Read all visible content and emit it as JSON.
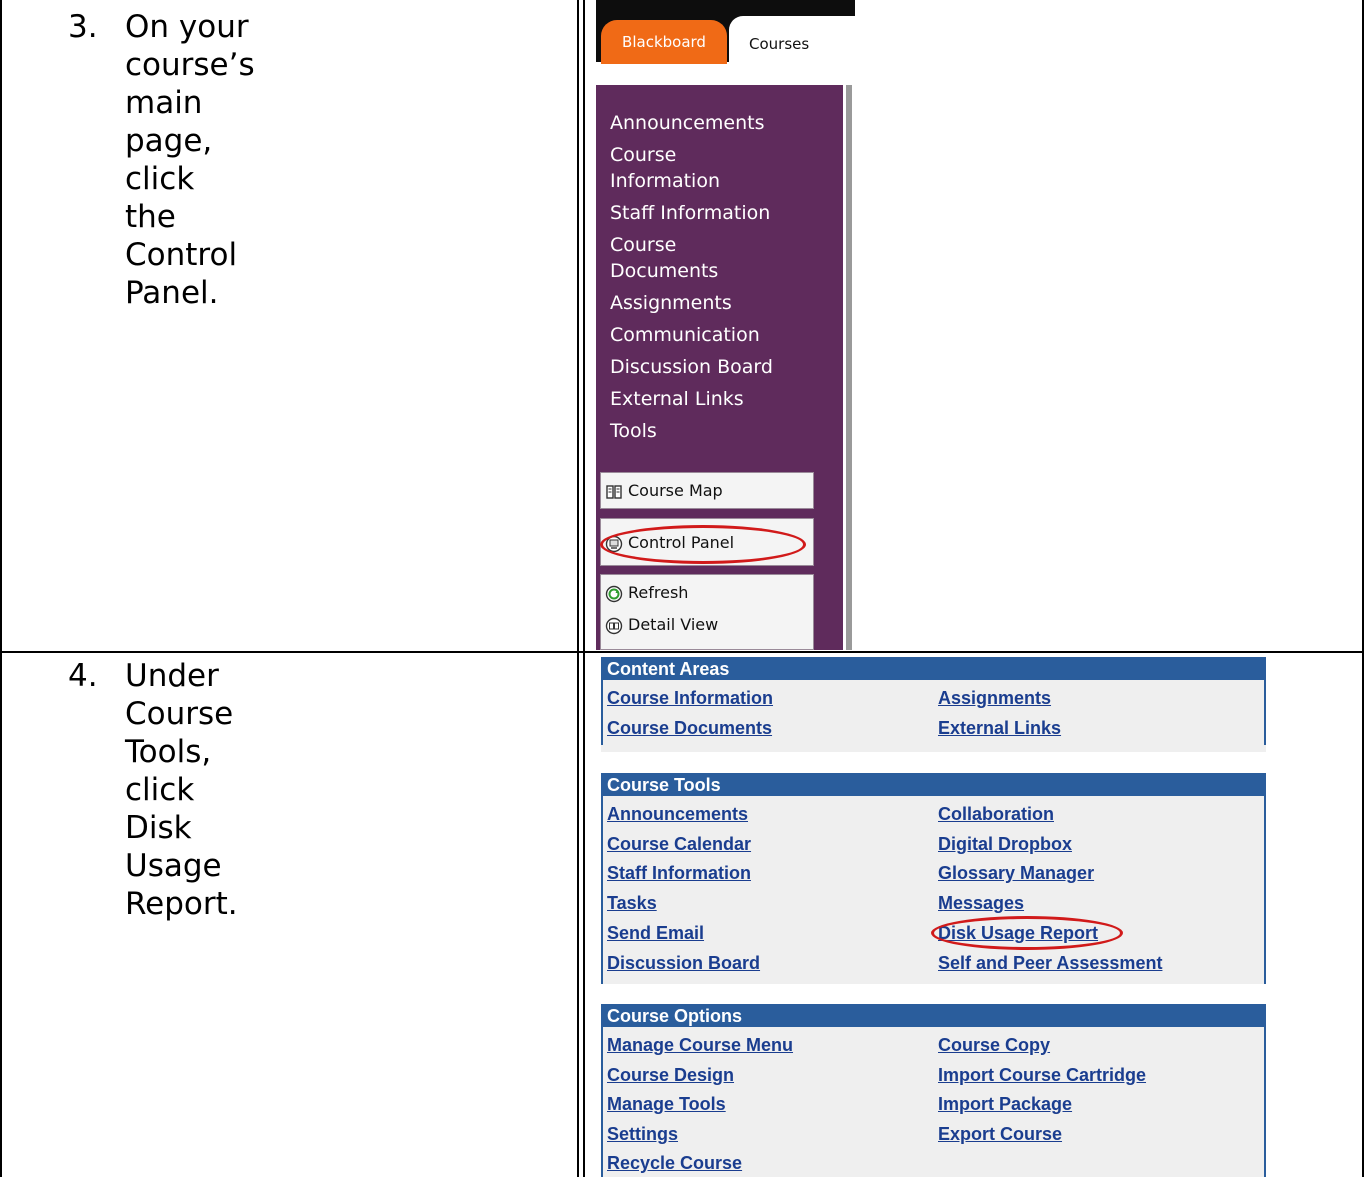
{
  "steps": [
    {
      "num": "3.",
      "text": "On your course’s main\npage, click the Control\nPanel."
    },
    {
      "num": "4.",
      "text": "Under Course Tools, click\nDisk Usage Report."
    }
  ],
  "blackboard": {
    "tabs": {
      "blackboard": "Blackboard",
      "courses": "Courses"
    },
    "nav_items": [
      "Announcements",
      "Course\nInformation",
      "Staff Information",
      "Course\nDocuments",
      "Assignments",
      "Communication",
      "Discussion Board",
      "External Links",
      "Tools"
    ],
    "buttons": {
      "course_map": "Course Map",
      "control_panel": "Control Panel",
      "refresh": "Refresh",
      "detail_view": "Detail View"
    },
    "icons": {
      "course_map": "book-icon",
      "control_panel": "control-panel-icon",
      "refresh": "refresh-icon",
      "detail_view": "detail-view-icon"
    },
    "colors": {
      "tab_orange": "#f06a16",
      "nav_purple": "#5f2b5c",
      "highlight_red": "#d11a1a"
    }
  },
  "control_panel": {
    "sections": [
      {
        "title": "Content Areas",
        "left": [
          "Course Information",
          "Course Documents"
        ],
        "right": [
          "Assignments",
          "External Links"
        ]
      },
      {
        "title": "Course Tools",
        "left": [
          "Announcements",
          "Course Calendar",
          "Staff Information",
          "Tasks",
          "Send Email",
          "Discussion Board"
        ],
        "right": [
          "Collaboration",
          "Digital Dropbox",
          "Glossary Manager",
          "Messages",
          "Disk Usage Report",
          "Self and Peer Assessment"
        ]
      },
      {
        "title": "Course Options",
        "left": [
          "Manage Course Menu",
          "Course Design",
          "Manage Tools",
          "Settings",
          "Recycle Course"
        ],
        "right": [
          "Course Copy",
          "Import Course Cartridge",
          "Import Package",
          "Export Course"
        ]
      }
    ],
    "colors": {
      "header_blue": "#2a5d9c",
      "link_blue": "#1a3d8f",
      "highlight_red": "#d11a1a"
    }
  }
}
